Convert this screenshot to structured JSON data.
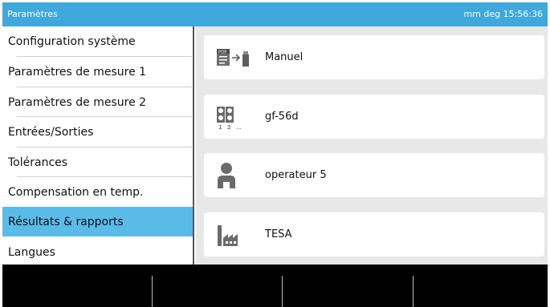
{
  "titlebar": {
    "title": "Paramètres",
    "status": "mm  deg  15:56:36"
  },
  "sidebar": {
    "items": [
      {
        "label": "Configuration système",
        "active": false
      },
      {
        "label": "Paramètres de mesure 1",
        "active": false
      },
      {
        "label": "Paramètres de mesure 2",
        "active": false
      },
      {
        "label": "Entrées/Sorties",
        "active": false
      },
      {
        "label": "Tolérances",
        "active": false
      },
      {
        "label": "Compensation en temp.",
        "active": false
      },
      {
        "label": "Résultats & rapports",
        "active": true
      },
      {
        "label": "Langues",
        "active": false
      }
    ]
  },
  "cards": [
    {
      "label": "Manuel",
      "icon": "pdf-export-icon"
    },
    {
      "label": "gf-56d",
      "icon": "measure-sequence-icon"
    },
    {
      "label": "operateur 5",
      "icon": "operator-icon"
    },
    {
      "label": "TESA",
      "icon": "factory-icon"
    }
  ],
  "icon_text": {
    "pdf": "PDF",
    "seq_1": "1",
    "seq_2": "2",
    "seq_more": "..."
  },
  "colors": {
    "titlebar": "#3fa8dc",
    "active_item": "#5bbbe8",
    "panel_bg": "#e8e8e8",
    "bottombar": "#000000"
  }
}
